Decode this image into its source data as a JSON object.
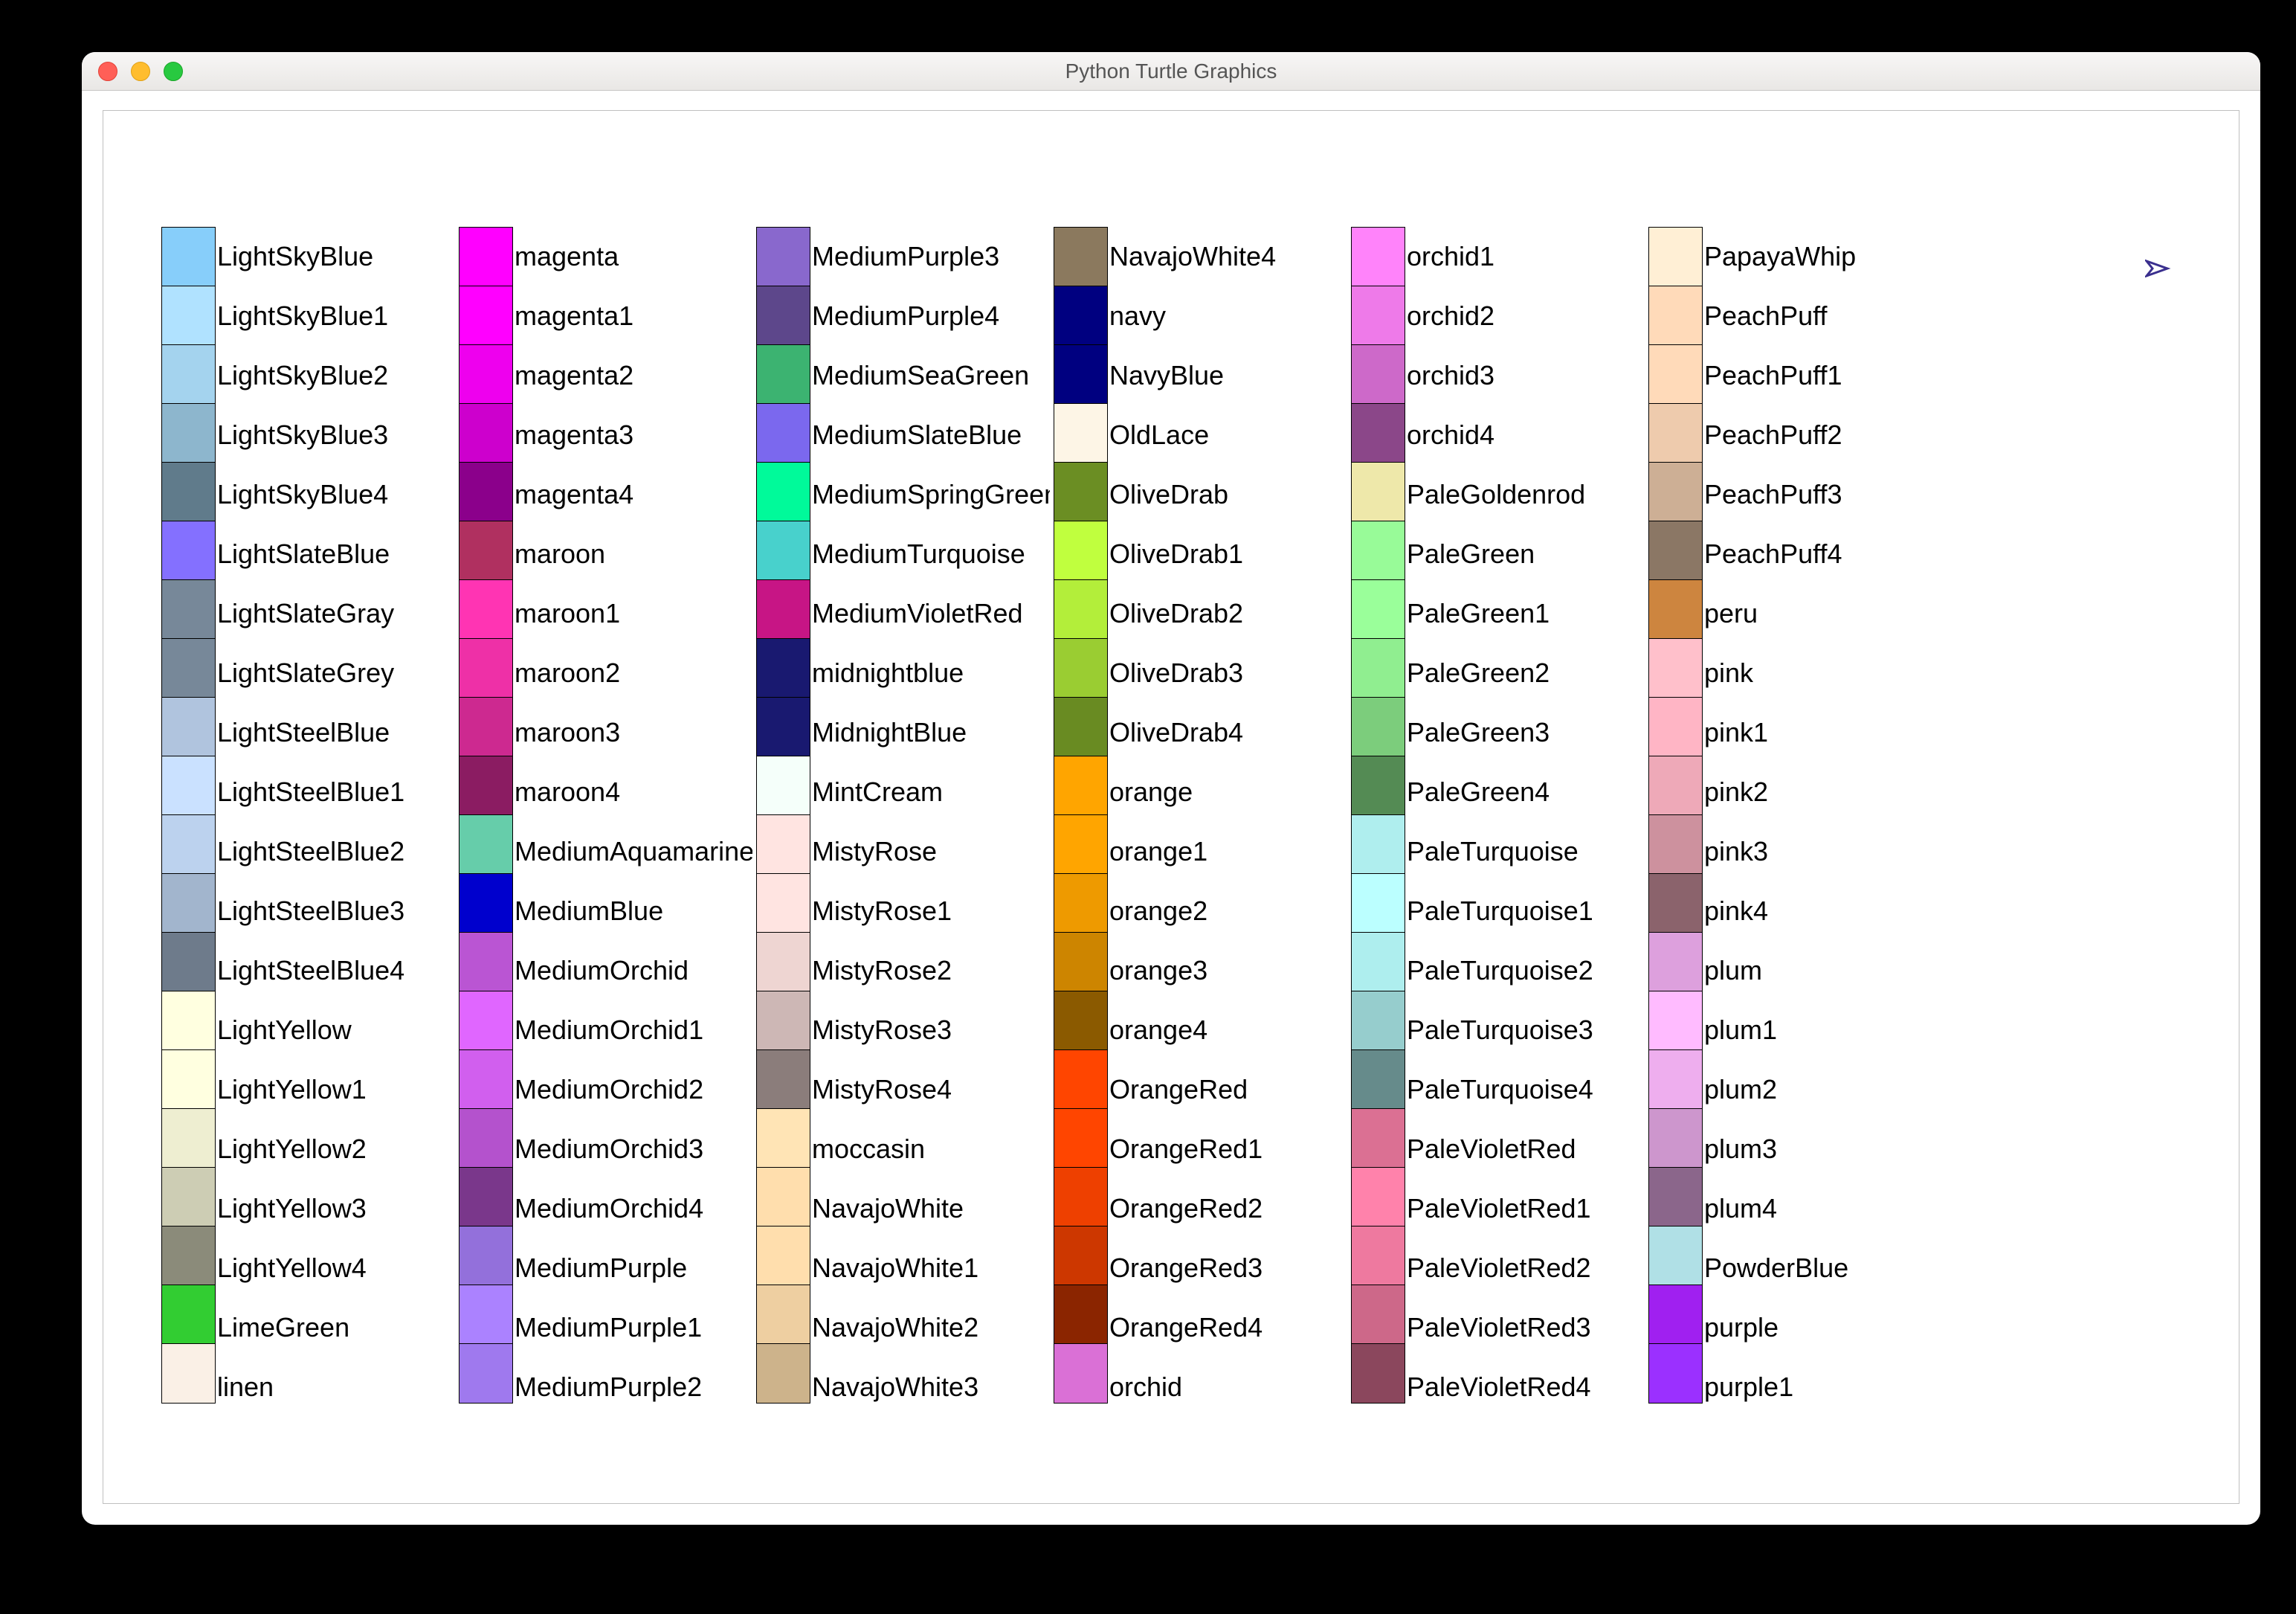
{
  "window": {
    "title": "Python Turtle Graphics"
  },
  "columns": [
    [
      {
        "name": "LightSkyBlue",
        "hex": "#87CEFA"
      },
      {
        "name": "LightSkyBlue1",
        "hex": "#B0E2FF"
      },
      {
        "name": "LightSkyBlue2",
        "hex": "#A4D3EE"
      },
      {
        "name": "LightSkyBlue3",
        "hex": "#8DB6CD"
      },
      {
        "name": "LightSkyBlue4",
        "hex": "#607B8B"
      },
      {
        "name": "LightSlateBlue",
        "hex": "#8470FF"
      },
      {
        "name": "LightSlateGray",
        "hex": "#778899"
      },
      {
        "name": "LightSlateGrey",
        "hex": "#778899"
      },
      {
        "name": "LightSteelBlue",
        "hex": "#B0C4DE"
      },
      {
        "name": "LightSteelBlue1",
        "hex": "#CAE1FF"
      },
      {
        "name": "LightSteelBlue2",
        "hex": "#BCD2EE"
      },
      {
        "name": "LightSteelBlue3",
        "hex": "#A2B5CD"
      },
      {
        "name": "LightSteelBlue4",
        "hex": "#6E7B8B"
      },
      {
        "name": "LightYellow",
        "hex": "#FFFFE0"
      },
      {
        "name": "LightYellow1",
        "hex": "#FFFFE0"
      },
      {
        "name": "LightYellow2",
        "hex": "#EEEED1"
      },
      {
        "name": "LightYellow3",
        "hex": "#CDCDB4"
      },
      {
        "name": "LightYellow4",
        "hex": "#8B8B7A"
      },
      {
        "name": "LimeGreen",
        "hex": "#32CD32"
      },
      {
        "name": "linen",
        "hex": "#FAF0E6"
      }
    ],
    [
      {
        "name": "magenta",
        "hex": "#FF00FF"
      },
      {
        "name": "magenta1",
        "hex": "#FF00FF"
      },
      {
        "name": "magenta2",
        "hex": "#EE00EE"
      },
      {
        "name": "magenta3",
        "hex": "#CD00CD"
      },
      {
        "name": "magenta4",
        "hex": "#8B008B"
      },
      {
        "name": "maroon",
        "hex": "#B03060"
      },
      {
        "name": "maroon1",
        "hex": "#FF34B3"
      },
      {
        "name": "maroon2",
        "hex": "#EE30A7"
      },
      {
        "name": "maroon3",
        "hex": "#CD2990"
      },
      {
        "name": "maroon4",
        "hex": "#8B1C62"
      },
      {
        "name": "MediumAquamarine",
        "hex": "#66CDAA"
      },
      {
        "name": "MediumBlue",
        "hex": "#0000CD"
      },
      {
        "name": "MediumOrchid",
        "hex": "#BA55D3"
      },
      {
        "name": "MediumOrchid1",
        "hex": "#E066FF"
      },
      {
        "name": "MediumOrchid2",
        "hex": "#D15FEE"
      },
      {
        "name": "MediumOrchid3",
        "hex": "#B452CD"
      },
      {
        "name": "MediumOrchid4",
        "hex": "#7A378B"
      },
      {
        "name": "MediumPurple",
        "hex": "#9370DB"
      },
      {
        "name": "MediumPurple1",
        "hex": "#AB82FF"
      },
      {
        "name": "MediumPurple2",
        "hex": "#9F79EE"
      }
    ],
    [
      {
        "name": "MediumPurple3",
        "hex": "#8968CD"
      },
      {
        "name": "MediumPurple4",
        "hex": "#5D478B"
      },
      {
        "name": "MediumSeaGreen",
        "hex": "#3CB371"
      },
      {
        "name": "MediumSlateBlue",
        "hex": "#7B68EE"
      },
      {
        "name": "MediumSpringGreen",
        "hex": "#00FA9A"
      },
      {
        "name": "MediumTurquoise",
        "hex": "#48D1CC"
      },
      {
        "name": "MediumVioletRed",
        "hex": "#C71585"
      },
      {
        "name": "midnightblue",
        "hex": "#191970"
      },
      {
        "name": "MidnightBlue",
        "hex": "#191970"
      },
      {
        "name": "MintCream",
        "hex": "#F5FFFA"
      },
      {
        "name": "MistyRose",
        "hex": "#FFE4E1"
      },
      {
        "name": "MistyRose1",
        "hex": "#FFE4E1"
      },
      {
        "name": "MistyRose2",
        "hex": "#EED5D2"
      },
      {
        "name": "MistyRose3",
        "hex": "#CDB7B5"
      },
      {
        "name": "MistyRose4",
        "hex": "#8B7D7B"
      },
      {
        "name": "moccasin",
        "hex": "#FFE4B5"
      },
      {
        "name": "NavajoWhite",
        "hex": "#FFDEAD"
      },
      {
        "name": "NavajoWhite1",
        "hex": "#FFDEAD"
      },
      {
        "name": "NavajoWhite2",
        "hex": "#EECFA1"
      },
      {
        "name": "NavajoWhite3",
        "hex": "#CDB38B"
      }
    ],
    [
      {
        "name": "NavajoWhite4",
        "hex": "#8B795E"
      },
      {
        "name": "navy",
        "hex": "#000080"
      },
      {
        "name": "NavyBlue",
        "hex": "#000080"
      },
      {
        "name": "OldLace",
        "hex": "#FDF5E6"
      },
      {
        "name": "OliveDrab",
        "hex": "#6B8E23"
      },
      {
        "name": "OliveDrab1",
        "hex": "#C0FF3E"
      },
      {
        "name": "OliveDrab2",
        "hex": "#B3EE3A"
      },
      {
        "name": "OliveDrab3",
        "hex": "#9ACD32"
      },
      {
        "name": "OliveDrab4",
        "hex": "#698B22"
      },
      {
        "name": "orange",
        "hex": "#FFA500"
      },
      {
        "name": "orange1",
        "hex": "#FFA500"
      },
      {
        "name": "orange2",
        "hex": "#EE9A00"
      },
      {
        "name": "orange3",
        "hex": "#CD8500"
      },
      {
        "name": "orange4",
        "hex": "#8B5A00"
      },
      {
        "name": "OrangeRed",
        "hex": "#FF4500"
      },
      {
        "name": "OrangeRed1",
        "hex": "#FF4500"
      },
      {
        "name": "OrangeRed2",
        "hex": "#EE4000"
      },
      {
        "name": "OrangeRed3",
        "hex": "#CD3700"
      },
      {
        "name": "OrangeRed4",
        "hex": "#8B2500"
      },
      {
        "name": "orchid",
        "hex": "#DA70D6"
      }
    ],
    [
      {
        "name": "orchid1",
        "hex": "#FF83FA"
      },
      {
        "name": "orchid2",
        "hex": "#EE7AE9"
      },
      {
        "name": "orchid3",
        "hex": "#CD69C9"
      },
      {
        "name": "orchid4",
        "hex": "#8B4789"
      },
      {
        "name": "PaleGoldenrod",
        "hex": "#EEE8AA"
      },
      {
        "name": "PaleGreen",
        "hex": "#98FB98"
      },
      {
        "name": "PaleGreen1",
        "hex": "#9AFF9A"
      },
      {
        "name": "PaleGreen2",
        "hex": "#90EE90"
      },
      {
        "name": "PaleGreen3",
        "hex": "#7CCD7C"
      },
      {
        "name": "PaleGreen4",
        "hex": "#548B54"
      },
      {
        "name": "PaleTurquoise",
        "hex": "#AFEEEE"
      },
      {
        "name": "PaleTurquoise1",
        "hex": "#BBFFFF"
      },
      {
        "name": "PaleTurquoise2",
        "hex": "#AEEEEE"
      },
      {
        "name": "PaleTurquoise3",
        "hex": "#96CDCD"
      },
      {
        "name": "PaleTurquoise4",
        "hex": "#668B8B"
      },
      {
        "name": "PaleVioletRed",
        "hex": "#DB7093"
      },
      {
        "name": "PaleVioletRed1",
        "hex": "#FF82AB"
      },
      {
        "name": "PaleVioletRed2",
        "hex": "#EE799F"
      },
      {
        "name": "PaleVioletRed3",
        "hex": "#CD6889"
      },
      {
        "name": "PaleVioletRed4",
        "hex": "#8B475D"
      }
    ],
    [
      {
        "name": "PapayaWhip",
        "hex": "#FFEFD5"
      },
      {
        "name": "PeachPuff",
        "hex": "#FFDAB9"
      },
      {
        "name": "PeachPuff1",
        "hex": "#FFDAB9"
      },
      {
        "name": "PeachPuff2",
        "hex": "#EECBAD"
      },
      {
        "name": "PeachPuff3",
        "hex": "#CDAF95"
      },
      {
        "name": "PeachPuff4",
        "hex": "#8B7765"
      },
      {
        "name": "peru",
        "hex": "#CD853F"
      },
      {
        "name": "pink",
        "hex": "#FFC0CB"
      },
      {
        "name": "pink1",
        "hex": "#FFB5C5"
      },
      {
        "name": "pink2",
        "hex": "#EEA9B8"
      },
      {
        "name": "pink3",
        "hex": "#CD919E"
      },
      {
        "name": "pink4",
        "hex": "#8B636C"
      },
      {
        "name": "plum",
        "hex": "#DDA0DD"
      },
      {
        "name": "plum1",
        "hex": "#FFBBFF"
      },
      {
        "name": "plum2",
        "hex": "#EEAEEE"
      },
      {
        "name": "plum3",
        "hex": "#CD96CD"
      },
      {
        "name": "plum4",
        "hex": "#8B668B"
      },
      {
        "name": "PowderBlue",
        "hex": "#B0E0E6"
      },
      {
        "name": "purple",
        "hex": "#A020F0"
      },
      {
        "name": "purple1",
        "hex": "#9B30FF"
      }
    ]
  ]
}
